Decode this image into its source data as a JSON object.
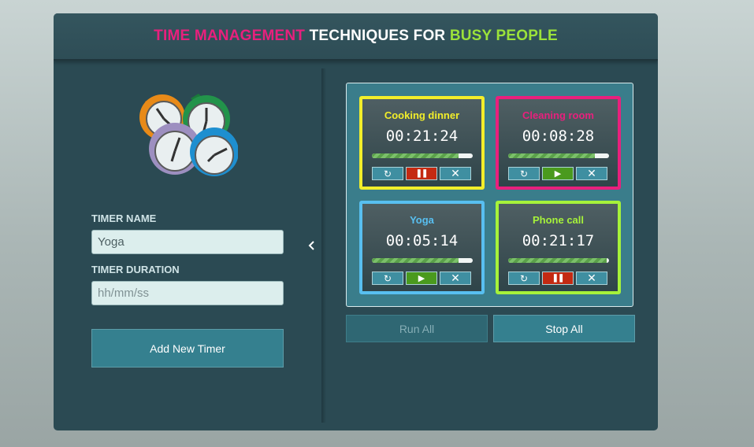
{
  "header": {
    "title_part1": "TIME MANAGEMENT",
    "title_part2": " TECHNIQUES FOR ",
    "title_part3": "BUSY PEOPLE",
    "colors": {
      "part1": "#e8207d",
      "part2": "#ffffff",
      "part3": "#9be23a"
    }
  },
  "form": {
    "logo_icon": "alarm-clocks-icon",
    "name_label": "TIMER NAME",
    "name_value": "Yoga",
    "duration_label": "TIMER DURATION",
    "duration_placeholder": "hh/mm/ss",
    "add_button": "Add New Timer",
    "collapse_icon": "chevron-left-icon"
  },
  "timers": [
    {
      "name": "Cooking dinner",
      "time": "00:21:24",
      "color": "#f2ee2a",
      "progress": 0.86,
      "state_button": "pause"
    },
    {
      "name": "Cleaning room",
      "time": "00:08:28",
      "color": "#e8207d",
      "progress": 0.86,
      "state_button": "play"
    },
    {
      "name": "Yoga",
      "time": "00:05:14",
      "color": "#58bff0",
      "progress": 0.86,
      "state_button": "play"
    },
    {
      "name": "Phone call",
      "time": "00:21:17",
      "color": "#a6f23a",
      "progress": 0.98,
      "state_button": "pause"
    }
  ],
  "controls": {
    "reset_icon": "refresh-icon",
    "pause_icon": "pause-icon",
    "play_icon": "play-icon",
    "remove_icon": "close-icon",
    "reset_glyph": "↻",
    "pause_glyph": "❚❚",
    "play_glyph": "▶",
    "remove_glyph": "✕"
  },
  "footer": {
    "run_all": "Run All",
    "stop_all": "Stop All"
  }
}
